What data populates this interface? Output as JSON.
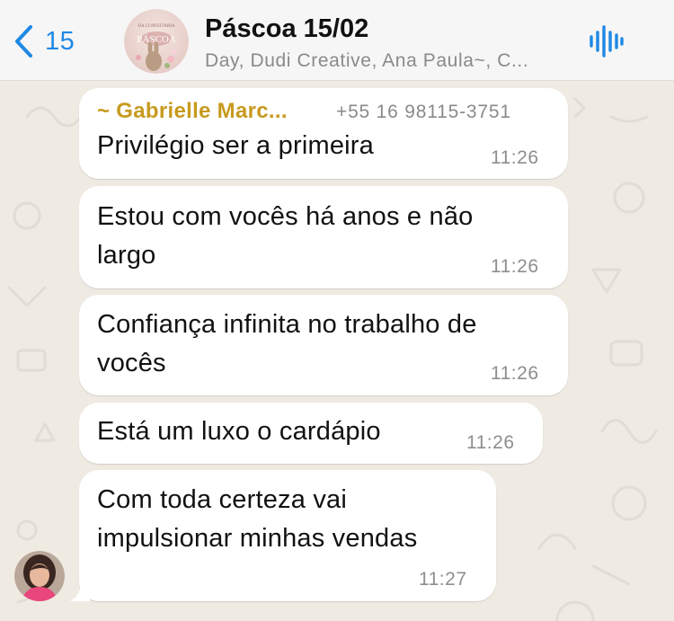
{
  "header": {
    "back_count": "15",
    "title": "Páscoa 15/02",
    "members": "Day, Dudi Creative, Ana Paula~, C...",
    "avatar_text": "PÁSCOA",
    "avatar_subtext": "DA CONFEITARIA"
  },
  "colors": {
    "accent": "#1e88e5",
    "sender_name": "#c79a1e",
    "chat_background": "#efeae2",
    "bubble": "#ffffff"
  },
  "messages": [
    {
      "sender": "~ Gabrielle Marc...",
      "phone": "+55 16 98115-3751",
      "lines": [
        "Privilégio ser a primeira"
      ],
      "time": "11:26"
    },
    {
      "lines": [
        "Estou com vocês há anos e não",
        "largo"
      ],
      "time": "11:26"
    },
    {
      "lines": [
        "Confiança infinita no trabalho de",
        "vocês"
      ],
      "time": "11:26"
    },
    {
      "lines": [
        "Está um luxo o cardápio"
      ],
      "time": "11:26"
    },
    {
      "lines": [
        "Com toda certeza vai",
        "impulsionar minhas vendas"
      ],
      "time": "11:27"
    }
  ]
}
